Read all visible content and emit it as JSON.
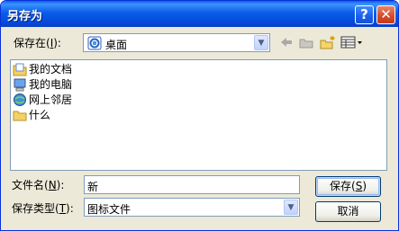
{
  "window": {
    "title": "另存为"
  },
  "titlebar": {
    "help_glyph": "?",
    "close_glyph": "✕"
  },
  "save_in": {
    "label": "保存在(",
    "hotkey": "I",
    "label_end": "):",
    "value": "桌面"
  },
  "files": [
    {
      "name": "我的文档",
      "icon": "my-documents-icon"
    },
    {
      "name": "我的电脑",
      "icon": "my-computer-icon"
    },
    {
      "name": "网上邻居",
      "icon": "network-places-icon"
    },
    {
      "name": "什么",
      "icon": "folder-icon"
    }
  ],
  "filename": {
    "label": "文件名(",
    "hotkey": "N",
    "label_end": "):",
    "value": "新"
  },
  "filetype": {
    "label": "保存类型(",
    "hotkey": "T",
    "label_end": "):",
    "value": "图标文件"
  },
  "buttons": {
    "save": "保存(",
    "save_hotkey": "S",
    "save_end": ")",
    "cancel": "取消"
  },
  "colors": {
    "title_bar": "#0a5de7",
    "dialog_bg": "#ece9d8",
    "border": "#7f9db9"
  }
}
